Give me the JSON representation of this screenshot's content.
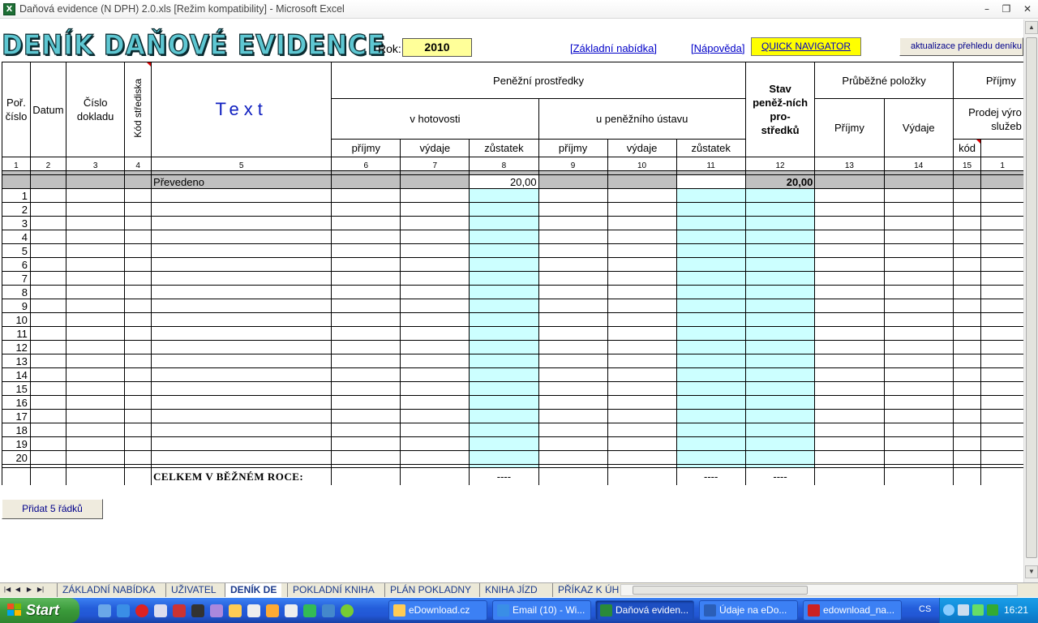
{
  "window": {
    "title": "Daňová evidence (N DPH) 2.0.xls  [Režim kompatibility] - Microsoft Excel",
    "icon": "excel-icon"
  },
  "header": {
    "big_title": "DENÍK DAŇOVÉ EVIDENCE",
    "rok_label": "Rok:",
    "rok_value": "2010",
    "link_zakladni": "[Základní nabídka]",
    "link_napoveda": "[Nápověda]",
    "quick_nav": "QUICK NAVIGATOR",
    "update_button": "aktualizace přehledu deníku"
  },
  "table": {
    "headers": {
      "por_cislo": "Poř. číslo",
      "datum": "Datum",
      "cislo_dokladu": "Číslo dokladu",
      "kod_strediska": "Kód střediska",
      "text": "Text",
      "penezni_prostredky": "Peněžní prostředky",
      "v_hotovosti": "v hotovosti",
      "u_penezniho_ustavu": "u peněžního ústavu",
      "prijmy": "příjmy",
      "vydaje": "výdaje",
      "zustatek": "zůstatek",
      "stav": "Stav peněž-ních pro-středků",
      "prubezne": "Průběžné položky",
      "prubezne_prijmy": "Příjmy",
      "prubezne_vydaje": "Výdaje",
      "prijmy_cut": "Příjmy",
      "prodej": "Prodej výro služeb",
      "kod": "kód"
    },
    "col_numbers": [
      "1",
      "2",
      "3",
      "4",
      "5",
      "6",
      "7",
      "8",
      "9",
      "10",
      "11",
      "12",
      "13",
      "14",
      "15",
      "1"
    ],
    "prevedeno": {
      "label": "Převedeno",
      "zustatek_hotovost": "20,00",
      "stav": "20,00"
    },
    "row_numbers": [
      "1",
      "2",
      "3",
      "4",
      "5",
      "6",
      "7",
      "8",
      "9",
      "10",
      "11",
      "12",
      "13",
      "14",
      "15",
      "16",
      "17",
      "18",
      "19",
      "20"
    ],
    "total": {
      "label": "CELKEM V BĚŽNÉM ROCE:",
      "col8": "----",
      "col11": "----",
      "col12": "----"
    }
  },
  "add_rows_button": "Přidat 5 řádků",
  "sheet_tabs": {
    "items": [
      "ZÁKLADNÍ NABÍDKA",
      "UŽIVATEL",
      "DENÍK DE",
      "POKLADNÍ KNIHA",
      "PLÁN POKLADNY",
      "KNIHA JÍZD",
      "PŘÍKAZ K ÚH"
    ],
    "active": "DENÍK DE"
  },
  "taskbar": {
    "start": "Start",
    "tasks": [
      "eDownload.cz",
      "Email (10) - Wi...",
      "Daňová eviden...",
      "Údaje na eDo...",
      "edownload_na..."
    ],
    "active_task": "Daňová eviden...",
    "language": "CS",
    "clock": "16:21"
  },
  "colors": {
    "cyan_cell": "#ccffff",
    "rok_bg": "#ffff99",
    "quick_nav_bg": "#ffff00",
    "gray_row": "#c0c0c0",
    "title_text": "#5ec7d2"
  }
}
